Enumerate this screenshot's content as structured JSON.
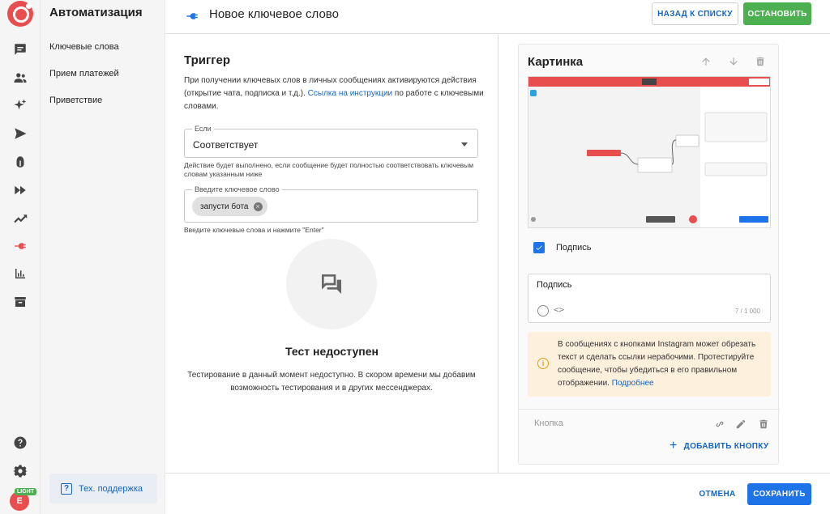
{
  "nav": {
    "title": "Автоматизация",
    "items": [
      {
        "label": "Ключевые слова"
      },
      {
        "label": "Прием платежей"
      },
      {
        "label": "Приветствие"
      }
    ],
    "support_label": "Тех. поддержка"
  },
  "user": {
    "initial": "E",
    "plan_badge": "LIGHT"
  },
  "header": {
    "title": "Новое ключевое слово",
    "back_label": "НАЗАД К СПИСКУ",
    "stop_label": "ОСТАНОВИТЬ"
  },
  "trigger": {
    "title": "Триггер",
    "desc_before": "При получении ключевых слов в личных сообщениях активируются действия (открытие чата, подписка и т.д.). ",
    "desc_link": "Ссылка на инструкции",
    "desc_after": " по работе с ключевыми словами.",
    "condition": {
      "label": "Если",
      "value": "Соответствует",
      "helper": "Действие будет выполнено, если сообщение будет полностью соответствовать ключевым словам указанным ниже"
    },
    "keywords": {
      "label": "Введите ключевое слово",
      "chip": "запусти бота",
      "helper": "Введите ключевые слова и нажмите \"Enter\""
    }
  },
  "test": {
    "title": "Тест недоступен",
    "desc": "Тестирование в данный момент недоступно. В скором времени мы добавим возможность тестирования и в других мессенджерах."
  },
  "picture_card": {
    "title": "Картинка",
    "caption_checkbox_label": "Подпись",
    "caption_checked": true,
    "caption_text": "Подпись",
    "caption_counter": "7 / 1 000",
    "warning_text": "В сообщениях с кнопками Instagram может обрезать текст и сделать ссылки нерабочими. Протестируйте сообщение, чтобы убедиться в его правильном отображении. ",
    "warning_link": "Подробнее",
    "button_placeholder": "Кнопка",
    "add_button_label": "ДОБАВИТЬ КНОПКУ"
  },
  "footer": {
    "cancel_label": "ОТМЕНА",
    "save_label": "СОХРАНИТЬ"
  },
  "colors": {
    "brand": "#e94e4e",
    "primary": "#1e73e8",
    "success": "#4caf50",
    "warning_bg": "#fdf0dc"
  },
  "icons": {
    "rail": [
      "chat-icon",
      "users-icon",
      "sparkle-icon",
      "send-icon",
      "bug-icon",
      "fast-forward-icon",
      "trending-icon",
      "plug-icon",
      "bar-chart-icon",
      "archive-icon",
      "help-icon",
      "settings-icon"
    ]
  }
}
